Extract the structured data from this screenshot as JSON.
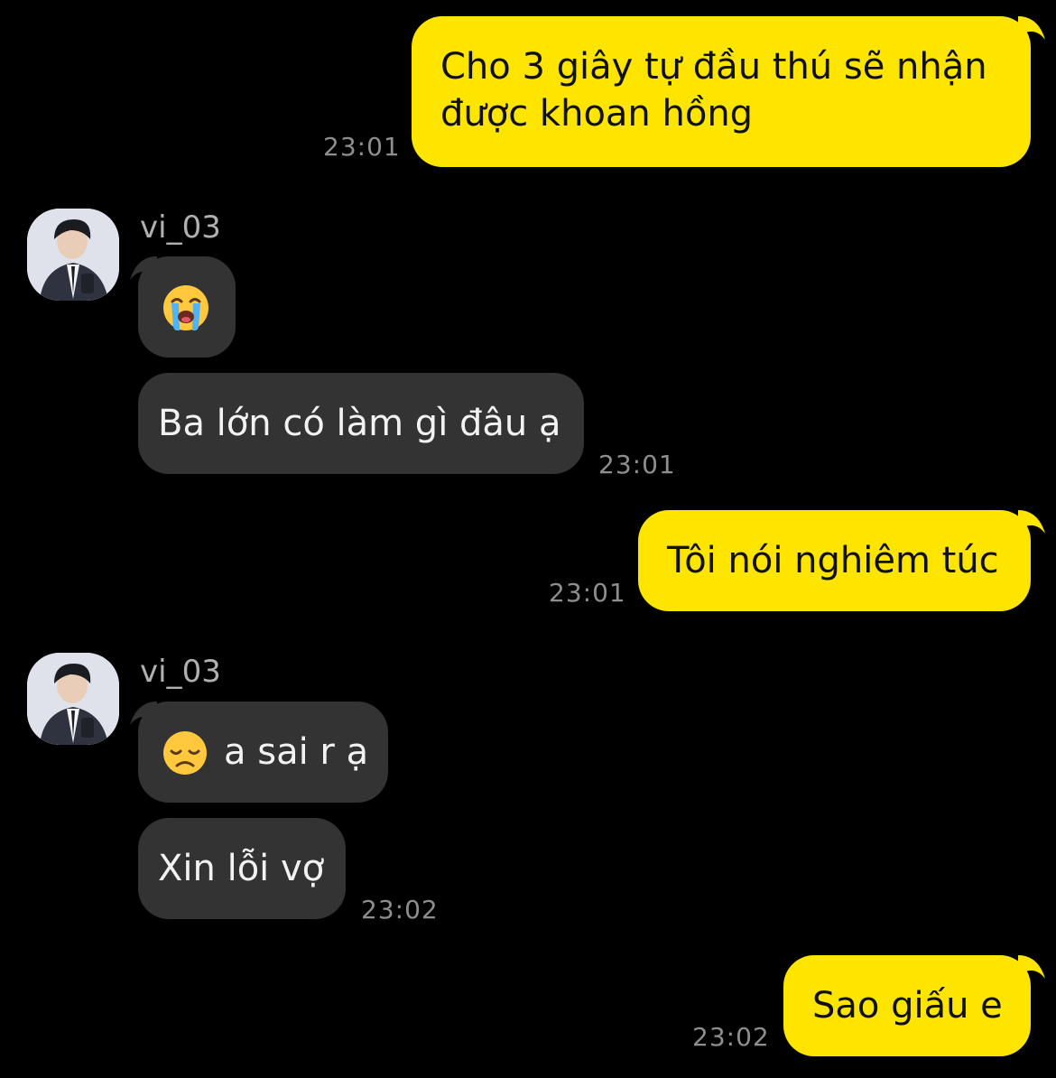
{
  "colors": {
    "background": "#000000",
    "outgoing_bubble": "#FEE500",
    "incoming_bubble": "#333333",
    "timestamp": "#8E8E8E",
    "sender_name": "#B0B0B0"
  },
  "messages": [
    {
      "direction": "outgoing",
      "text_lines": [
        "Cho 3 giây tự đầu thú sẽ nhận",
        "được khoan hồng"
      ],
      "time": "23:01"
    },
    {
      "direction": "incoming",
      "sender": "vi_03",
      "emoji": "loudly-crying-face-emoji"
    },
    {
      "direction": "incoming",
      "text": "Ba lớn có làm gì đâu ạ",
      "time": "23:01"
    },
    {
      "direction": "outgoing",
      "text": "Tôi nói nghiêm túc",
      "time": "23:01"
    },
    {
      "direction": "incoming",
      "sender": "vi_03",
      "emoji": "disappointed-face-emoji",
      "text": "a sai r ạ"
    },
    {
      "direction": "incoming",
      "text": "Xin lỗi vợ",
      "time": "23:02"
    },
    {
      "direction": "outgoing",
      "text": "Sao giấu e",
      "time": "23:02"
    }
  ]
}
